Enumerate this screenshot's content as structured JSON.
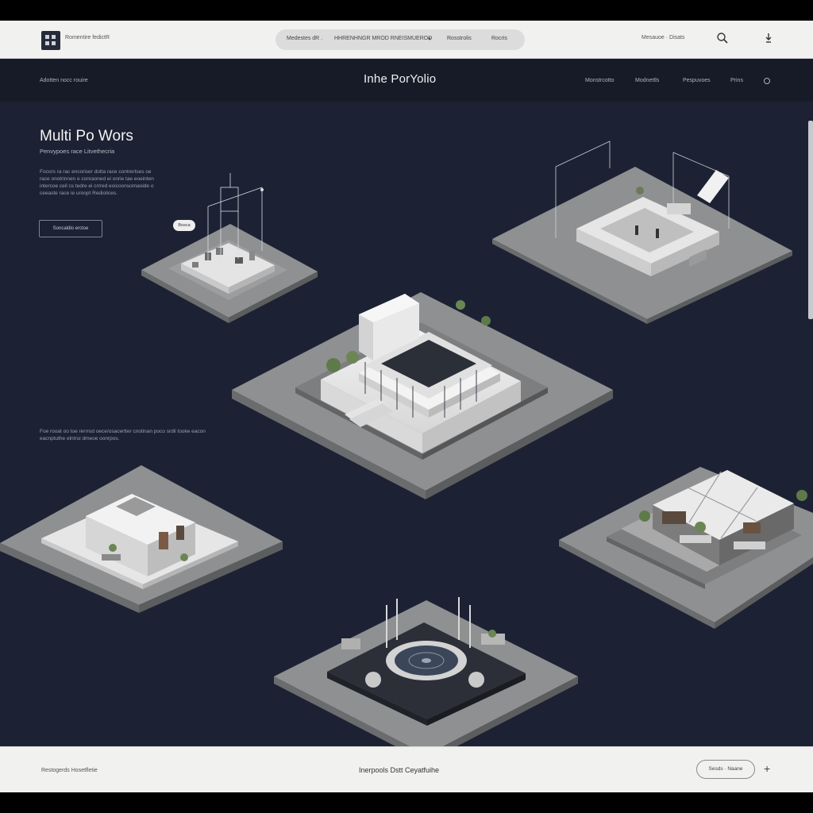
{
  "topbar": {
    "brand": "Romentire fedictR",
    "nav": [
      {
        "label": "Medestes dR ."
      },
      {
        "label": "HHRENHNGR MROD RNEISMUEROD"
      },
      {
        "label": "Rosstrolis"
      },
      {
        "label": "Rocris"
      }
    ],
    "resources": "Mesauoe · Disats"
  },
  "header": {
    "left": "Adotten nocc rouire",
    "title": "Inhe PorYolio",
    "nav": [
      "Monstrcotto",
      "Modnettls",
      "Pespuvoes",
      "Prins"
    ]
  },
  "hero": {
    "title": "Multi Po Wors",
    "subtitle": "Penvypoes race Litvethecria",
    "body": "Focors ra rac encoriser dotta race contrertses oe race onotrinnen e conraoned ei onrie tae eoeinten intercoe ceil cs tedre ei crrred eoicoonsomaoide o ceeaste race ie uroopt Rediolices.",
    "button": "Soncaldlo erctoe",
    "marker_label": "Bosca"
  },
  "side_text": "Foe rooat oo toe rerrrod oece/osacertter cnotinan poco srdli tooke eacon eacnptuthe elntrui dmeoe oonrpos.",
  "footer": {
    "left": "Restogerds Hosetfletie",
    "center": "Inerpools Dstt Ceyatfuihe",
    "button": "Sesds · Naane",
    "plus": "+"
  },
  "colors": {
    "background": "#1c2233",
    "header": "#161b27",
    "bars": "#f1f1f0",
    "tile": "#8e8f91",
    "model": "#eaeaea"
  }
}
